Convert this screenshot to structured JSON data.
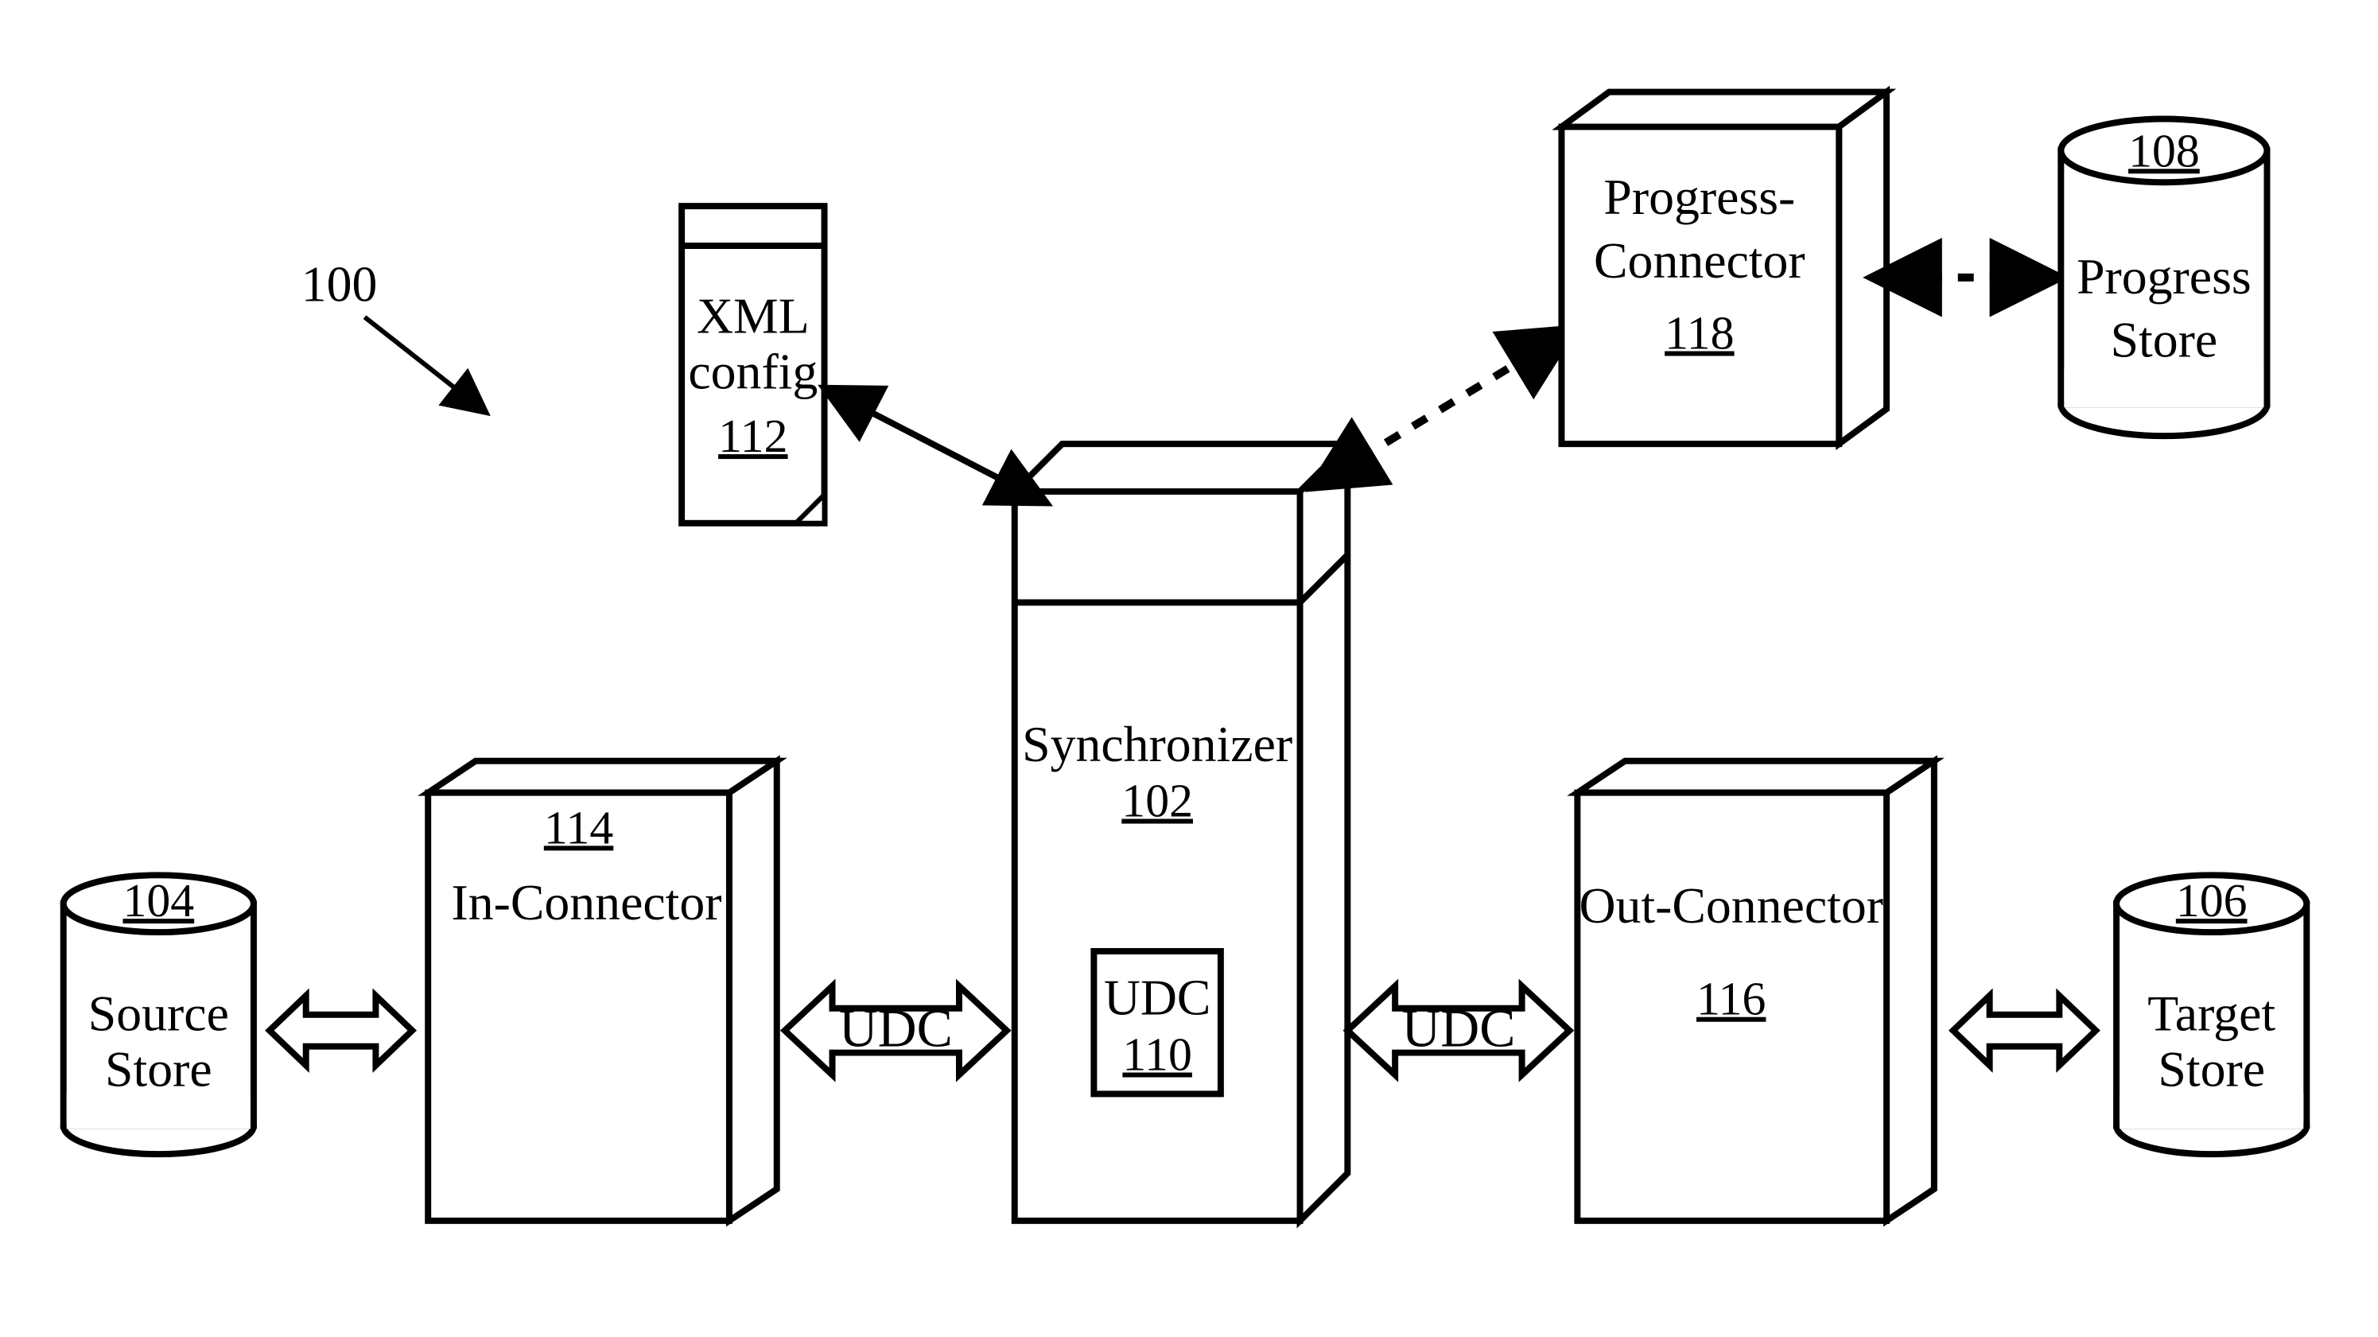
{
  "system_ref": "100",
  "nodes": {
    "source_store": {
      "label_a": "Source",
      "label_b": "Store",
      "ref": "104"
    },
    "target_store": {
      "label_a": "Target",
      "label_b": "Store",
      "ref": "106"
    },
    "progress_store": {
      "label_a": "Progress",
      "label_b": "Store",
      "ref": "108"
    },
    "in_connector": {
      "label": "In-Connector",
      "ref": "114"
    },
    "out_connector": {
      "label": "Out-Connector",
      "ref": "116"
    },
    "synchronizer": {
      "label": "Synchronizer",
      "ref": "102"
    },
    "udc": {
      "label": "UDC",
      "ref": "110"
    },
    "xml_config": {
      "label_a": "XML",
      "label_b": "config",
      "ref": "112"
    },
    "prog_connector": {
      "label_a": "Progress-",
      "label_b": "Connector",
      "ref": "118"
    }
  },
  "edges": {
    "udc_left": "UDC",
    "udc_right": "UDC"
  }
}
